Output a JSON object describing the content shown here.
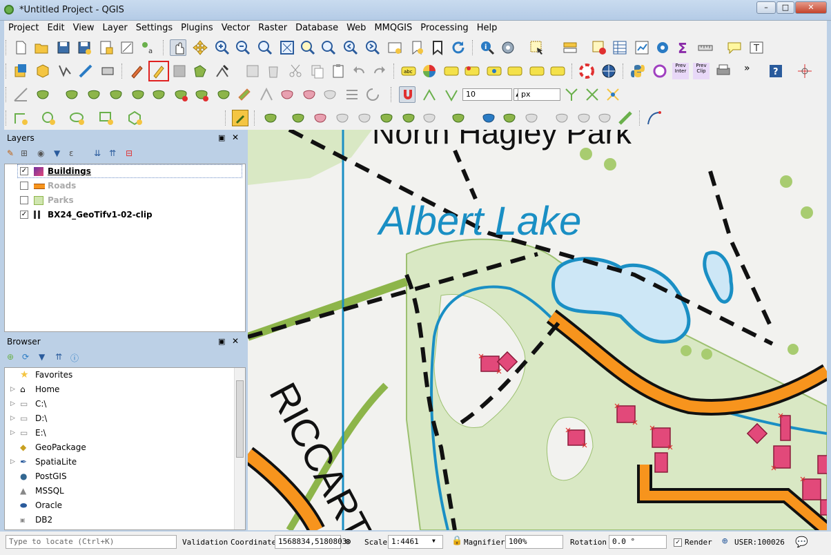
{
  "window": {
    "title": "*Untitled Project - QGIS",
    "minimize": "–",
    "maximize": "□",
    "close": "✕"
  },
  "menu": [
    "Project",
    "Edit",
    "View",
    "Layer",
    "Settings",
    "Plugins",
    "Vector",
    "Raster",
    "Database",
    "Web",
    "MMQGIS",
    "Processing",
    "Help"
  ],
  "toolbar": {
    "snap_tolerance": "10",
    "snap_units": "px",
    "prev_inter": "Prev\nInter",
    "prev_clip": "Prev\nClip"
  },
  "layers_panel": {
    "title": "Layers",
    "items": [
      {
        "name": "Buildings",
        "checked": true,
        "active": true
      },
      {
        "name": "Roads",
        "checked": false
      },
      {
        "name": "Parks",
        "checked": false
      },
      {
        "name": "BX24_GeoTifv1-02-clip",
        "checked": true
      }
    ]
  },
  "browser_panel": {
    "title": "Browser",
    "items": [
      "Favorites",
      "Home",
      "C:\\",
      "D:\\",
      "E:\\",
      "GeoPackage",
      "SpatiaLite",
      "PostGIS",
      "MSSQL",
      "Oracle",
      "DB2"
    ]
  },
  "map": {
    "label_park": "North Hagley Park",
    "label_lake": "Albert Lake",
    "label_street": "RICCART",
    "colors": {
      "road": "#f7941d",
      "water": "#1a8fc4",
      "park": "#8db54a",
      "building": "#e2497a",
      "lake_fill": "#cde7f6"
    }
  },
  "statusbar": {
    "locate_placeholder": "Type to locate (Ctrl+K)",
    "validation": "Validation",
    "coordinate_label": "Coordinate",
    "coordinate": "1568834,5180803",
    "scale_label": "Scale",
    "scale": "1:4461",
    "magnifier_label": "Magnifier",
    "magnifier": "100%",
    "rotation_label": "Rotation",
    "rotation": "0.0 °",
    "render_label": "Render",
    "crs": "USER:100026"
  }
}
